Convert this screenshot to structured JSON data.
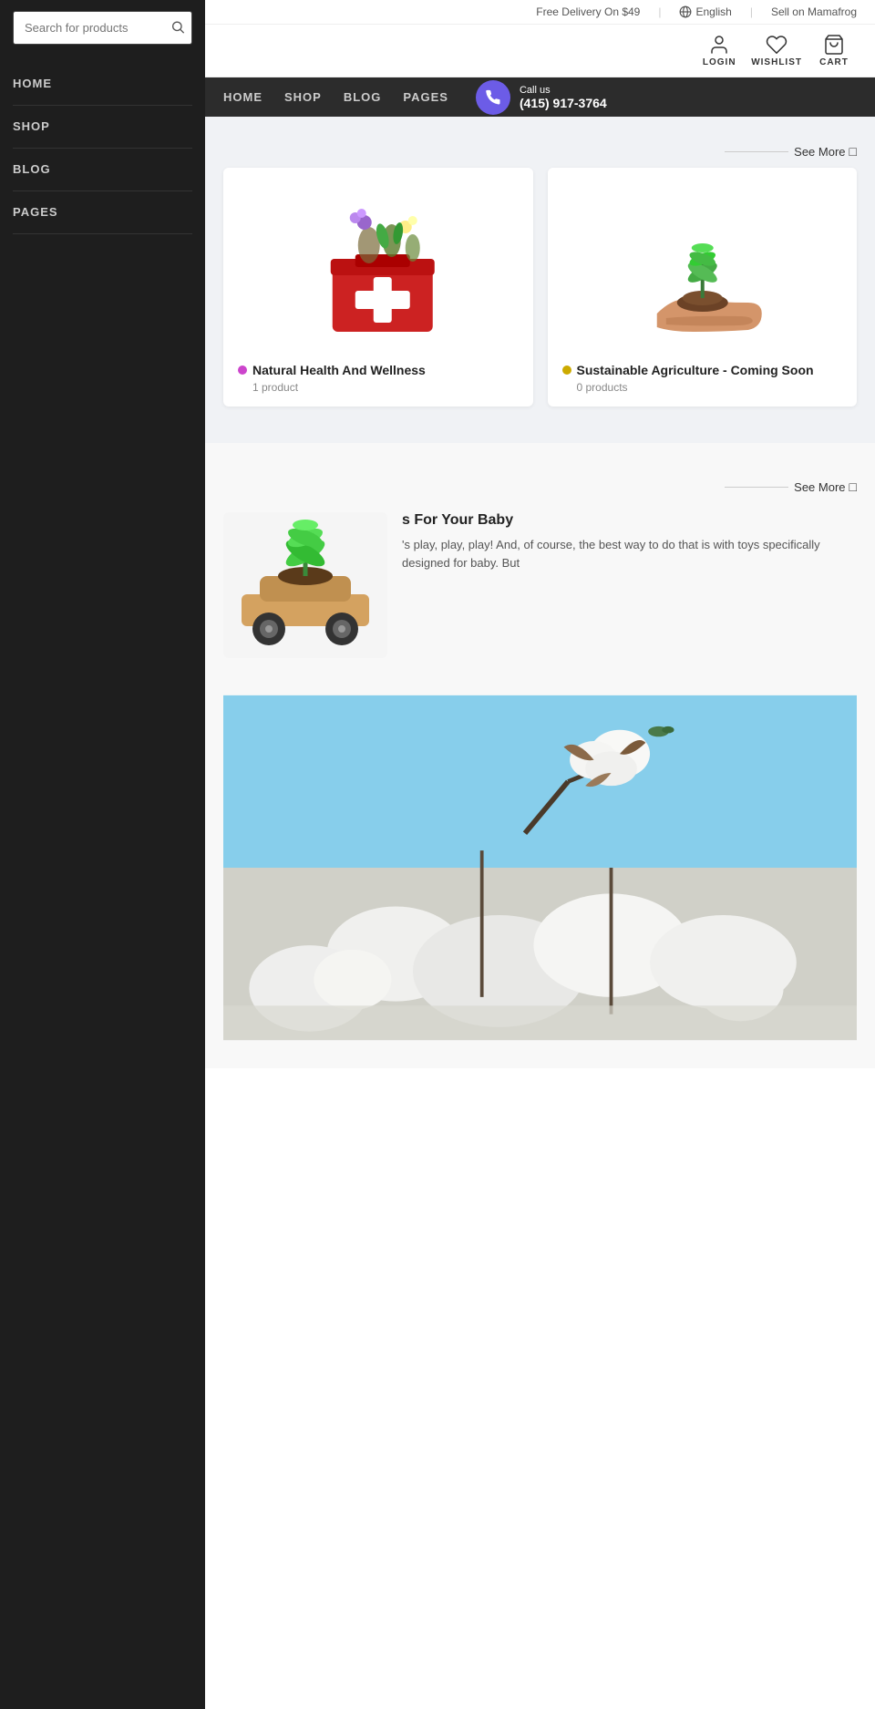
{
  "topbar": {
    "delivery": "Free Delivery On $49",
    "lang_icon": "🌐",
    "language": "English",
    "sell": "Sell on Mamafrog",
    "divider1": "|",
    "divider2": "|"
  },
  "header": {
    "login_label": "LOGIN",
    "wishlist_label": "WISHLIST",
    "cart_label": "CART"
  },
  "sidebar": {
    "close_char": "✕",
    "search_placeholder": "Search for products",
    "nav_items": [
      {
        "label": "HOME",
        "href": "#"
      },
      {
        "label": "SHOP",
        "href": "#"
      },
      {
        "label": "BLOG",
        "href": "#"
      },
      {
        "label": "PAGES",
        "href": "#"
      }
    ]
  },
  "navbar": {
    "call_label": "Call us",
    "phone": "(415) 917-3764",
    "links": [
      {
        "label": "HOME",
        "href": "#"
      },
      {
        "label": "SHOP",
        "href": "#"
      },
      {
        "label": "BLOG",
        "href": "#"
      },
      {
        "label": "PAGES",
        "href": "#"
      }
    ]
  },
  "categories_section1": {
    "see_more": "See More",
    "cards": [
      {
        "title": "Natural Health And Wellness",
        "count": "1 product",
        "dot_color": "#cc44cc"
      },
      {
        "title": "Sustainable Agriculture - Coming Soon",
        "count": "0 products",
        "dot_color": "#ccaa00"
      }
    ]
  },
  "categories_section2": {
    "see_more": "See More"
  },
  "blog_section": {
    "article_title": "s For Your Baby",
    "article_excerpt": "'s play, play, play! And, of course, the best way to do that is with toys specifically designed for baby. But"
  }
}
